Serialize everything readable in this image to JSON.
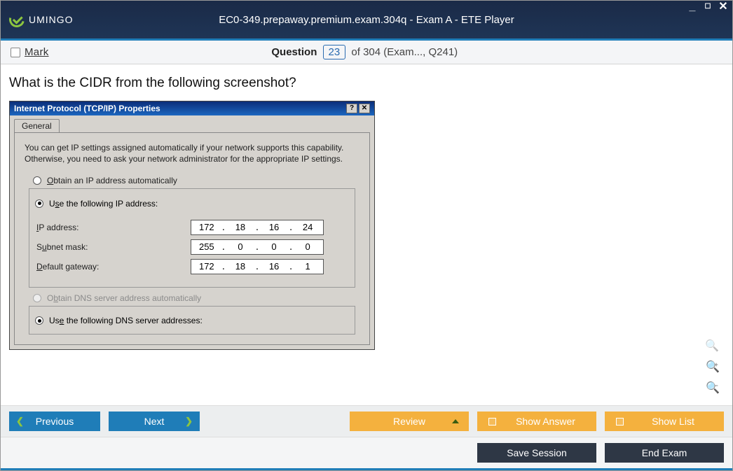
{
  "window": {
    "brand": "UMINGO",
    "title": "EC0-349.prepaway.premium.exam.304q - Exam A - ETE Player"
  },
  "subheader": {
    "mark_label": "Mark",
    "question_label": "Question",
    "current": "23",
    "of_label": "of",
    "total": "304",
    "context": "(Exam..., Q241)"
  },
  "question": {
    "text": "What is the CIDR from the following screenshot?"
  },
  "dialog": {
    "title": "Internet Protocol (TCP/IP) Properties",
    "tab": "General",
    "description": "You can get IP settings assigned automatically if your network supports this capability. Otherwise, you need to ask your network administrator for the appropriate IP settings.",
    "obtain_ip": "Obtain an IP address automatically",
    "use_ip": "Use the following IP address:",
    "labels": {
      "ip": "IP address:",
      "subnet": "Subnet mask:",
      "gateway": "Default gateway:"
    },
    "values": {
      "ip": [
        "172",
        "18",
        "16",
        "24"
      ],
      "subnet": [
        "255",
        "0",
        "0",
        "0"
      ],
      "gateway": [
        "172",
        "18",
        "16",
        "1"
      ]
    },
    "obtain_dns": "Obtain DNS server address automatically",
    "use_dns": "Use the following DNS server addresses:"
  },
  "buttons": {
    "previous": "Previous",
    "next": "Next",
    "review": "Review",
    "show_answer": "Show Answer",
    "show_list": "Show List",
    "save_session": "Save Session",
    "end_exam": "End Exam"
  }
}
